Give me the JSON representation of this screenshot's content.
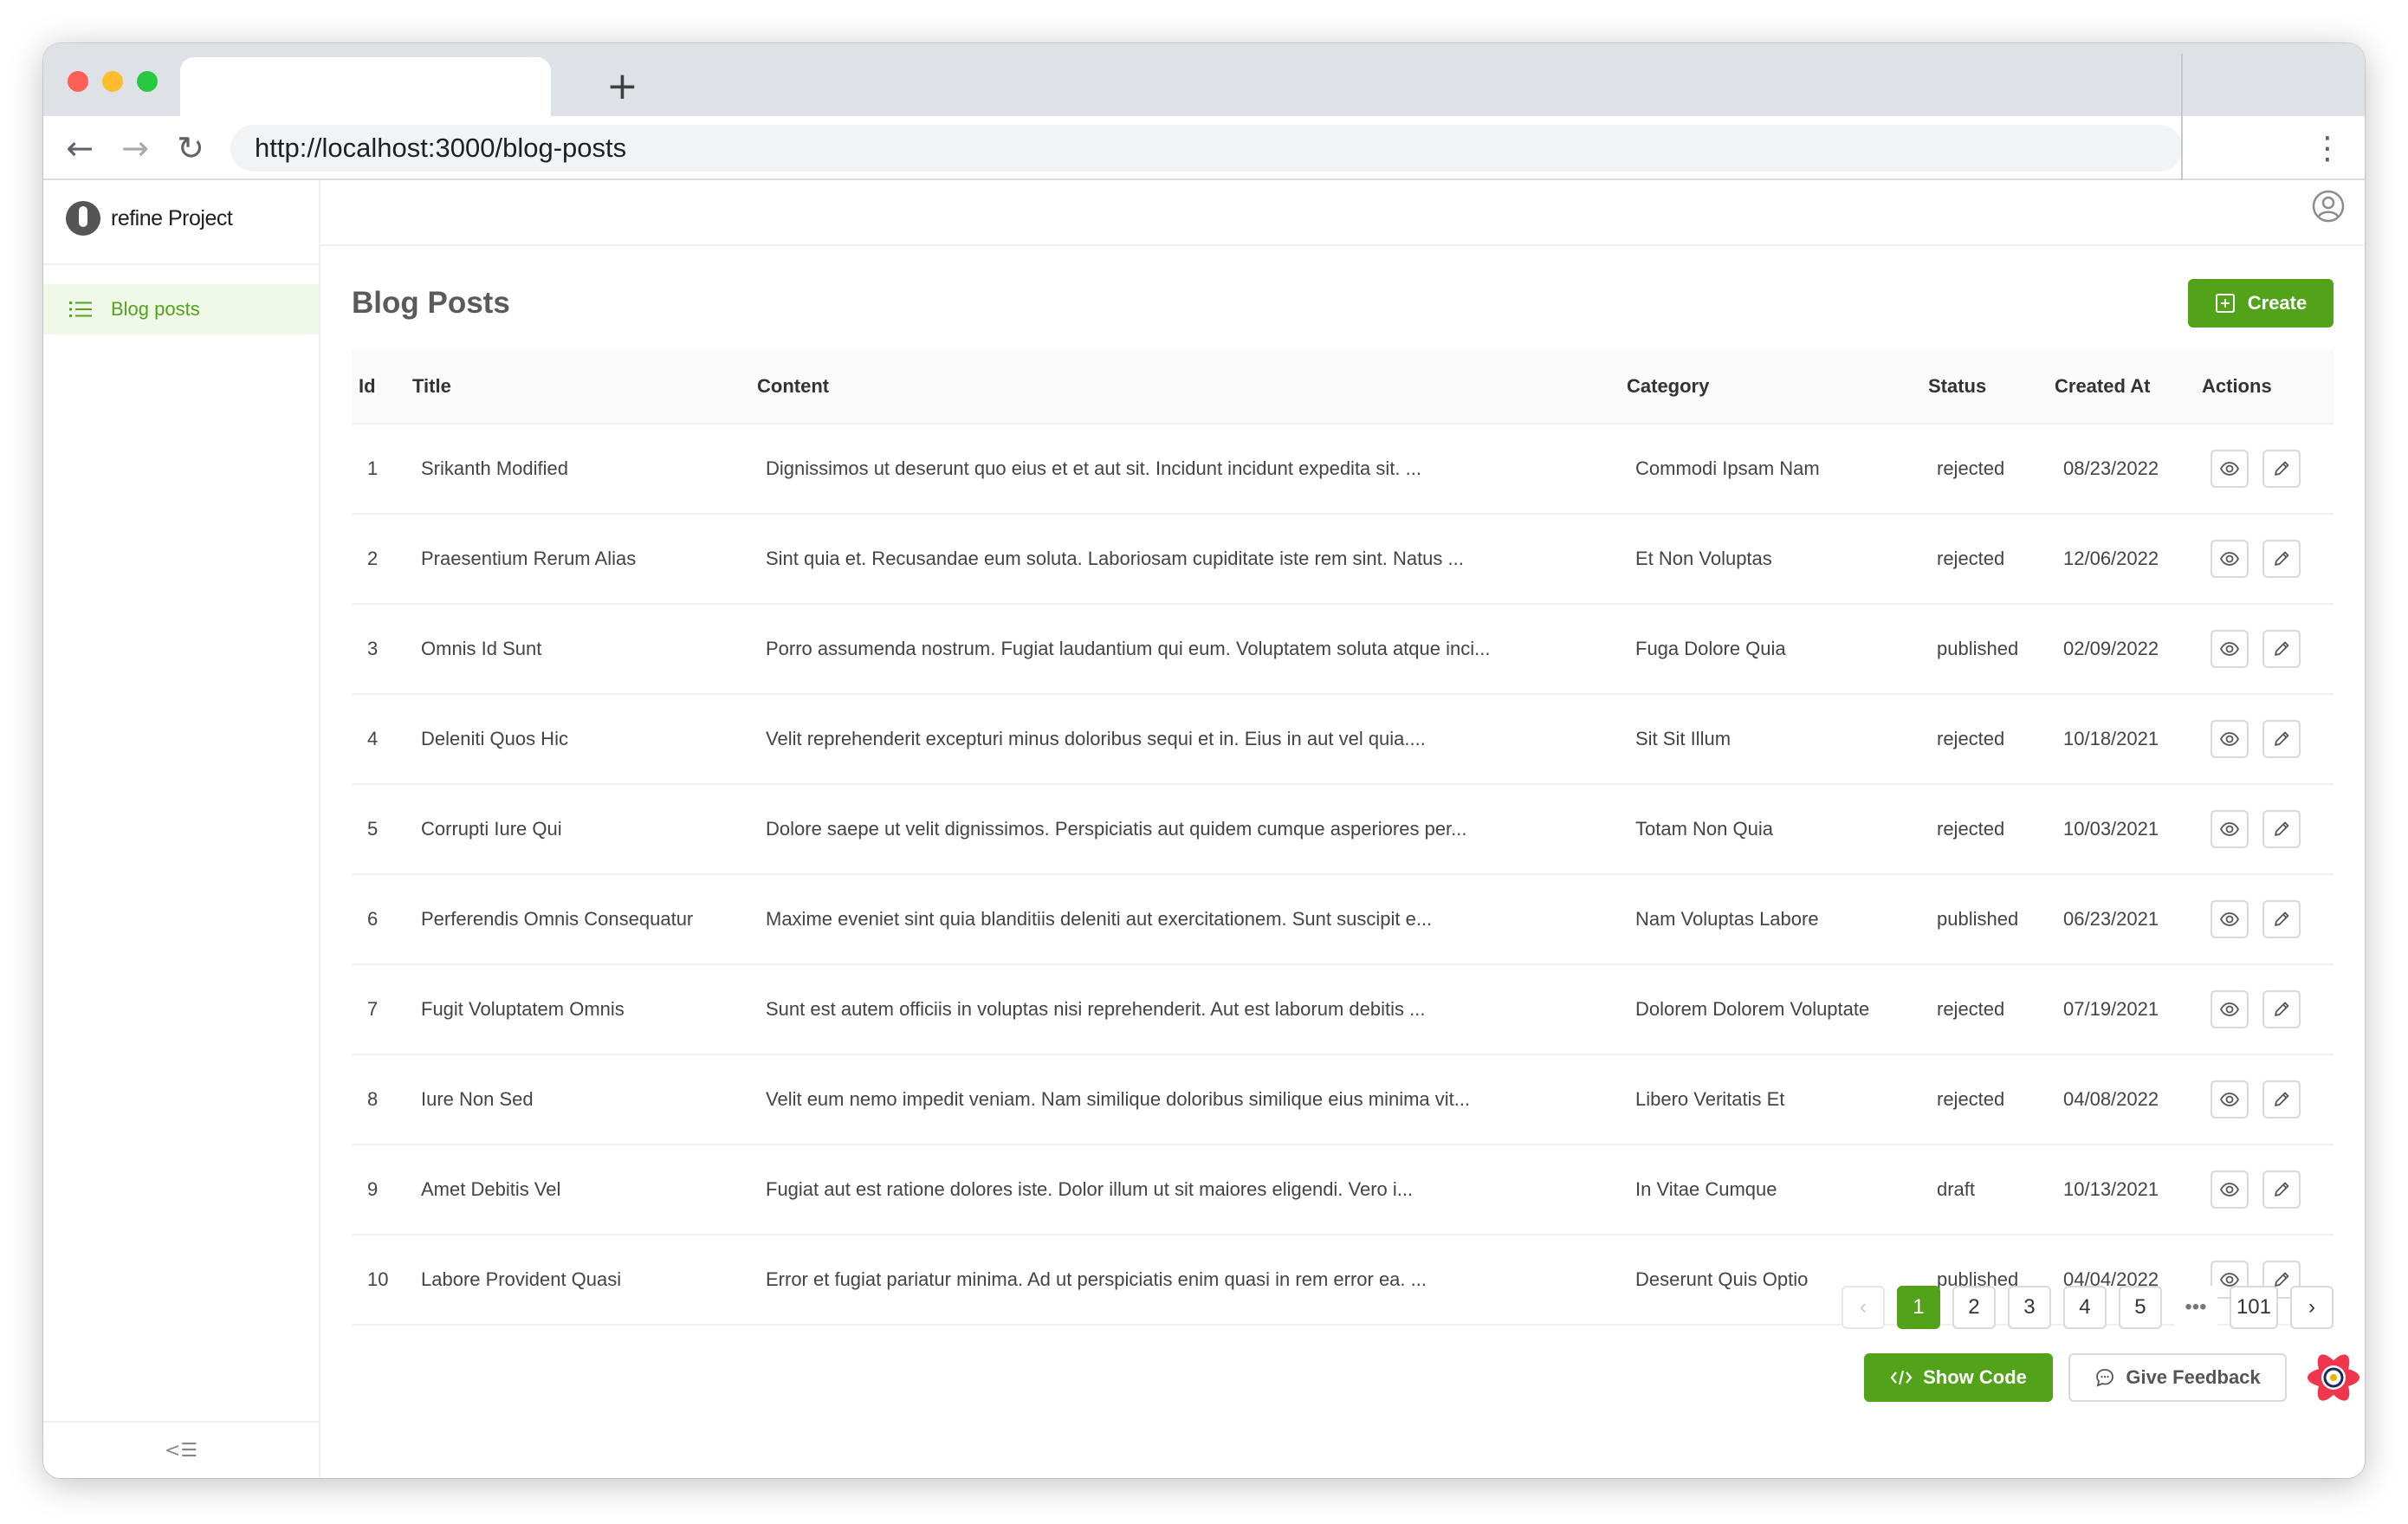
{
  "browser": {
    "url": "http://localhost:3000/blog-posts",
    "new_tab_label": "+",
    "back_glyph": "←",
    "forward_glyph": "→",
    "reload_glyph": "↻",
    "menu_glyph": "⋮"
  },
  "sidebar": {
    "app_name": "refine Project",
    "items": [
      {
        "label": "Blog posts",
        "icon": "list-icon",
        "active": true
      }
    ],
    "collapse_glyph": "<☰"
  },
  "page": {
    "title": "Blog Posts",
    "create_label": "Create"
  },
  "table": {
    "columns": [
      "Id",
      "Title",
      "Content",
      "Category",
      "Status",
      "Created At",
      "Actions"
    ],
    "rows": [
      {
        "id": "1",
        "title": "Srikanth Modified",
        "content": "Dignissimos ut deserunt quo eius et et aut sit. Incidunt incidunt expedita sit. ...",
        "category": "Commodi Ipsam Nam",
        "status": "rejected",
        "created_at": "08/23/2022"
      },
      {
        "id": "2",
        "title": "Praesentium Rerum Alias",
        "content": "Sint quia et. Recusandae eum soluta. Laboriosam cupiditate iste rem sint. Natus ...",
        "category": "Et Non Voluptas",
        "status": "rejected",
        "created_at": "12/06/2022"
      },
      {
        "id": "3",
        "title": "Omnis Id Sunt",
        "content": "Porro assumenda nostrum. Fugiat laudantium qui eum. Voluptatem soluta atque inci...",
        "category": "Fuga Dolore Quia",
        "status": "published",
        "created_at": "02/09/2022"
      },
      {
        "id": "4",
        "title": "Deleniti Quos Hic",
        "content": "Velit reprehenderit excepturi minus doloribus sequi et in. Eius in aut vel quia....",
        "category": "Sit Sit Illum",
        "status": "rejected",
        "created_at": "10/18/2021"
      },
      {
        "id": "5",
        "title": "Corrupti Iure Qui",
        "content": "Dolore saepe ut velit dignissimos. Perspiciatis aut quidem cumque asperiores per...",
        "category": "Totam Non Quia",
        "status": "rejected",
        "created_at": "10/03/2021"
      },
      {
        "id": "6",
        "title": "Perferendis Omnis Consequatur",
        "content": "Maxime eveniet sint quia blanditiis deleniti aut exercitationem. Sunt suscipit e...",
        "category": "Nam Voluptas Labore",
        "status": "published",
        "created_at": "06/23/2021"
      },
      {
        "id": "7",
        "title": "Fugit Voluptatem Omnis",
        "content": "Sunt est autem officiis in voluptas nisi reprehenderit. Aut est laborum debitis ...",
        "category": "Dolorem Dolorem Voluptate",
        "status": "rejected",
        "created_at": "07/19/2021"
      },
      {
        "id": "8",
        "title": "Iure Non Sed",
        "content": "Velit eum nemo impedit veniam. Nam similique doloribus similique eius minima vit...",
        "category": "Libero Veritatis Et",
        "status": "rejected",
        "created_at": "04/08/2022"
      },
      {
        "id": "9",
        "title": "Amet Debitis Vel",
        "content": "Fugiat aut est ratione dolores iste. Dolor illum ut sit maiores eligendi. Vero i...",
        "category": "In Vitae Cumque",
        "status": "draft",
        "created_at": "10/13/2021"
      },
      {
        "id": "10",
        "title": "Labore Provident Quasi",
        "content": "Error et fugiat pariatur minima. Ad ut perspiciatis enim quasi in rem error ea. ...",
        "category": "Deserunt Quis Optio",
        "status": "published",
        "created_at": "04/04/2022"
      }
    ]
  },
  "pagination": {
    "prev": "‹",
    "pages": [
      "1",
      "2",
      "3",
      "4",
      "5"
    ],
    "current": "1",
    "ellipsis": "•••",
    "last": "101",
    "next": "›"
  },
  "footer": {
    "show_code_label": "Show Code",
    "feedback_label": "Give Feedback"
  },
  "colors": {
    "accent": "#52a31a",
    "active_menu_bg": "#f0f8e9"
  }
}
